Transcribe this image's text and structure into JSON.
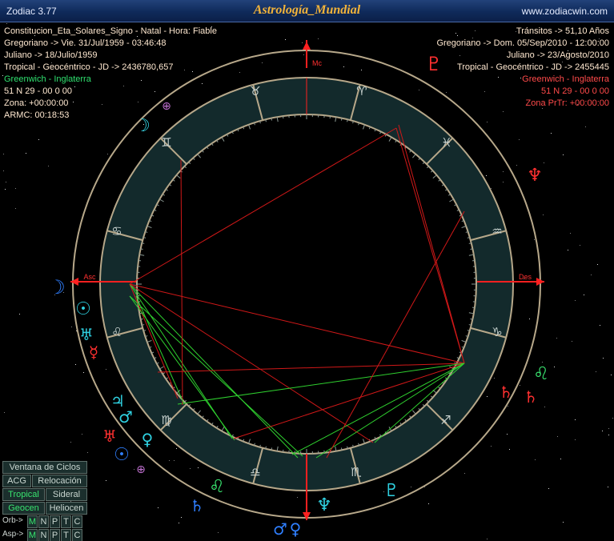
{
  "window": {
    "app_name": "Zodiac 3.77",
    "chart_title": "Astrología_Mundial",
    "site": "www.zodiacwin.com"
  },
  "natal": {
    "lines": [
      "Constitucion_Eta_Solares_Signo - Natal - Hora: Fiable",
      "Gregoriano -> Vie. 31/Jul/1959 - 03:46:48",
      "Juliano -> 18/Julio/1959",
      "Tropical - Geocéntrico - JD -> 2436780,657",
      "Greenwich - Inglaterra",
      "51 N 29 - 00 0 00",
      "Zona: +00:00:00",
      "ARMC: 00:18:53"
    ]
  },
  "transits": {
    "lines": [
      "Tránsitos -> 51,10 Años",
      "Gregoriano -> Dom. 05/Sep/2010 - 12:00:00",
      "Juliano -> 23/Agosto/2010",
      "Tropical - Geocéntrico - JD -> 2455445",
      "Greenwich - Inglaterra",
      "51 N 29 - 00 0 00",
      "Zona PrTr: +00:00:00"
    ]
  },
  "wheel": {
    "labels": {
      "mc": "Mc",
      "asc": "Asc",
      "des": "Des"
    },
    "signs": [
      {
        "symbol": "♈",
        "name": "aries-icon",
        "color": "#c8d2cf"
      },
      {
        "symbol": "♉",
        "name": "taurus-icon",
        "color": "#c8d2cf"
      },
      {
        "symbol": "♊",
        "name": "gemini-icon",
        "color": "#c8d2cf"
      },
      {
        "symbol": "♋",
        "name": "cancer-icon",
        "color": "#c8d2cf"
      },
      {
        "symbol": "♌",
        "name": "leo-icon",
        "color": "#c8d2cf"
      },
      {
        "symbol": "♍",
        "name": "virgo-icon",
        "color": "#c8d2cf"
      },
      {
        "symbol": "♎",
        "name": "libra-icon",
        "color": "#c8d2cf"
      },
      {
        "symbol": "♏",
        "name": "scorpio-icon",
        "color": "#c8d2cf"
      },
      {
        "symbol": "♐",
        "name": "sagittarius-icon",
        "color": "#c8d2cf"
      },
      {
        "symbol": "♑",
        "name": "capricorn-icon",
        "color": "#c8d2cf"
      },
      {
        "symbol": "♒",
        "name": "aquarius-icon",
        "color": "#c8d2cf"
      },
      {
        "symbol": "♓",
        "name": "pisces-icon",
        "color": "#c8d2cf"
      }
    ],
    "planets": [
      {
        "symbol": "☽",
        "name": "moon-natal-icon",
        "color": "#2fd0e0"
      },
      {
        "symbol": "⊕",
        "name": "part-of-fortune-natal-icon",
        "color": "#c070d0"
      },
      {
        "symbol": "☽",
        "name": "moon-transit-icon",
        "color": "#2f7fff"
      },
      {
        "symbol": "☉",
        "name": "sun-natal-icon",
        "color": "#2fd0e0"
      },
      {
        "symbol": "♅",
        "name": "uranus-natal-icon",
        "color": "#2fd0e0"
      },
      {
        "symbol": "☿",
        "name": "mercury-transit-icon",
        "color": "#ff3030"
      },
      {
        "symbol": "♃",
        "name": "jupiter-natal-icon",
        "color": "#2fd0e0"
      },
      {
        "symbol": "♂",
        "name": "mars-natal-icon",
        "color": "#2fd0e0"
      },
      {
        "symbol": "♅",
        "name": "uranus-transit-icon",
        "color": "#ff3030"
      },
      {
        "symbol": "♀",
        "name": "venus-natal-icon",
        "color": "#2fd0e0"
      },
      {
        "symbol": "☉",
        "name": "sun-transit-icon",
        "color": "#2f7fff"
      },
      {
        "symbol": "⊕",
        "name": "part-of-fortune-transit-icon",
        "color": "#c070d0"
      },
      {
        "symbol": "♌",
        "name": "node-natal-icon",
        "color": "#39e36f"
      },
      {
        "symbol": "♄",
        "name": "saturn-transit-icon",
        "color": "#2f7fff"
      },
      {
        "symbol": "♆",
        "name": "neptune-natal-icon",
        "color": "#2fd0e0"
      },
      {
        "symbol": "♂",
        "name": "mars-transit-icon",
        "color": "#2f7fff"
      },
      {
        "symbol": "♀",
        "name": "venus-transit-icon",
        "color": "#2f7fff"
      },
      {
        "symbol": "♇",
        "name": "pluto-natal-icon",
        "color": "#2fd0e0"
      },
      {
        "symbol": "♌",
        "name": "node-transit-icon",
        "color": "#39e36f"
      },
      {
        "symbol": "♄",
        "name": "saturn-natal-icon",
        "color": "#ff3030"
      },
      {
        "symbol": "♄",
        "name": "saturn-natal-2-icon",
        "color": "#ff3030"
      },
      {
        "symbol": "♆",
        "name": "neptune-transit-icon",
        "color": "#ff3030"
      },
      {
        "symbol": "♇",
        "name": "pluto-transit-icon",
        "color": "#ff3030"
      }
    ]
  },
  "panel": {
    "ciclos": "Ventana de Ciclos",
    "acg": "ACG",
    "relocacion": "Relocación",
    "tropical": "Tropical",
    "sideral": "Sideral",
    "geocen": "Geocen",
    "heliocen": "Heliocen",
    "orb_label": "Orb->",
    "asp_label": "Asp->",
    "toggles": [
      "M",
      "N",
      "P",
      "T",
      "C"
    ]
  }
}
